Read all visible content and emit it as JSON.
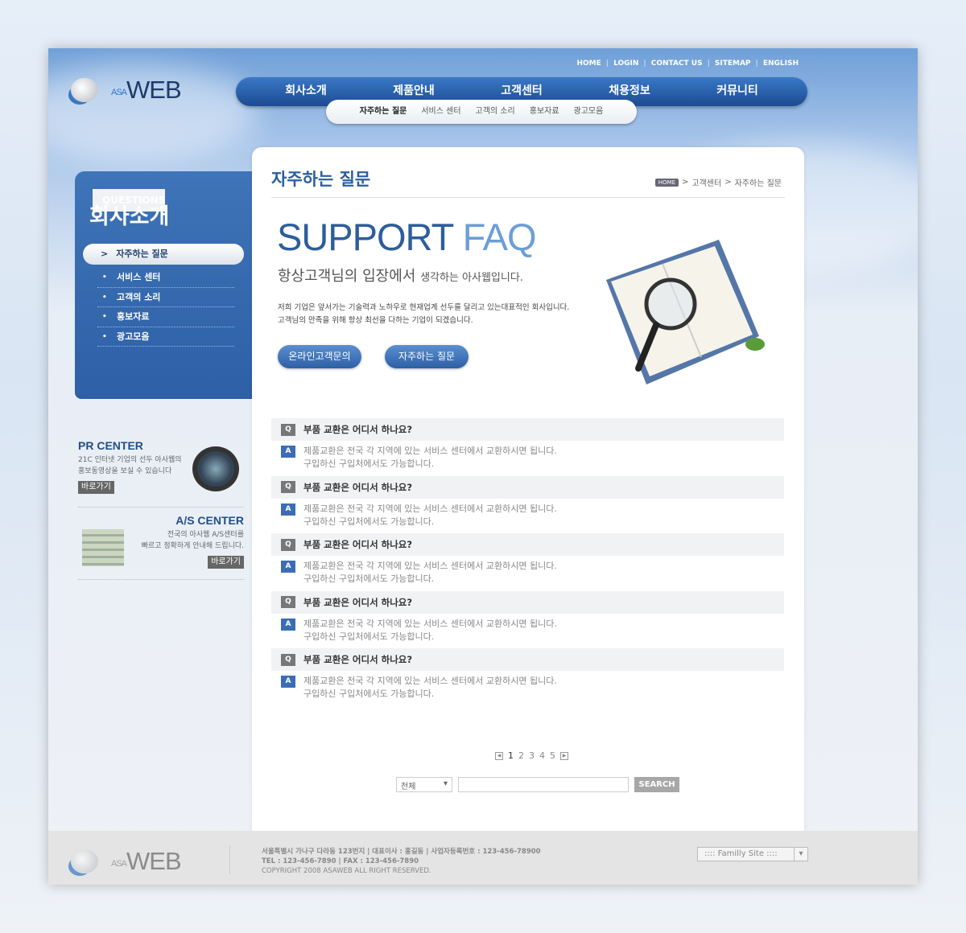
{
  "logo": {
    "a": "ASA",
    "b": "WEB"
  },
  "util_links": [
    "HOME",
    "LOGIN",
    "CONTACT US",
    "SITEMAP",
    "ENGLISH"
  ],
  "gnb": [
    "회사소개",
    "제품안내",
    "고객센터",
    "채용정보",
    "커뮤니티"
  ],
  "subnav": [
    "자주하는 질문",
    "서비스 센터",
    "고객의 소리",
    "홍보자료",
    "광고모음"
  ],
  "lnb": {
    "eyebrow": "QUESTIONS",
    "title": "회사소개",
    "active": "자주하는 질문",
    "items": [
      "서비스 센터",
      "고객의 소리",
      "홍보자료",
      "광고모음"
    ]
  },
  "pr": {
    "title": "PR CENTER",
    "line1": "21C 인터넷 기업의 선두 아사웹의",
    "line2": "홍보동영상을 보실 수 있습니다",
    "go": "바로가기"
  },
  "as": {
    "title": "A/S CENTER",
    "line1": "전국의 아사웹 A/S센터를",
    "line2": "빠르고 정확하게 안내해 드립니다.",
    "go": "바로가기"
  },
  "page": {
    "title": "자주하는 질문",
    "breadcrumb": [
      "HOME",
      "고객센터",
      "자주하는 질문"
    ],
    "hero_a": "SUPPORT",
    "hero_b": "FAQ",
    "lead": "항상고객님의 입장에서",
    "lead_small": "생각하는 아사웹입니다.",
    "desc1": "저희 기업은 앞서가는 기술력과 노하우로 현재업계 선두를 달리고 있는대표적인 회사입니다.",
    "desc2": "고객님의 만족을 위해 항상 최선을 다하는 기업이 되겠습니다.",
    "btn1": "온라인고객문의",
    "btn2": "자주하는 질문"
  },
  "faq": [
    {
      "q": "부품 교환은 어디서 하나요?",
      "a1": "제품교환은 전국 각 지역에 있는 서비스 센터에서 교환하시면 됩니다.",
      "a2": "구입하신 구입처에서도 가능합니다."
    },
    {
      "q": "부품 교환은 어디서 하나요?",
      "a1": "제품교환은 전국 각 지역에 있는 서비스 센터에서 교환하시면 됩니다.",
      "a2": "구입하신 구입처에서도 가능합니다."
    },
    {
      "q": "부품 교환은 어디서 하나요?",
      "a1": "제품교환은 전국 각 지역에 있는 서비스 센터에서 교환하시면 됩니다.",
      "a2": "구입하신 구입처에서도 가능합니다."
    },
    {
      "q": "부품 교환은 어디서 하나요?",
      "a1": "제품교환은 전국 각 지역에 있는 서비스 센터에서 교환하시면 됩니다.",
      "a2": "구입하신 구입처에서도 가능합니다."
    },
    {
      "q": "부품 교환은 어디서 하나요?",
      "a1": "제품교환은 전국 각 지역에 있는 서비스 센터에서 교환하시면 됩니다.",
      "a2": "구입하신 구입처에서도 가능합니다."
    }
  ],
  "tags": {
    "q": "Q",
    "a": "A"
  },
  "pager": {
    "prev": "◀",
    "next": "▶",
    "pages": [
      "1",
      "2",
      "3",
      "4",
      "5"
    ],
    "current": "1"
  },
  "search": {
    "select": "전체",
    "value": "",
    "button": "SEARCH"
  },
  "footer": {
    "line1": "서울특별시 가나구 다라동 123번지 | 대표이사 : 홍길동 | 사업자등록번호 : 123-456-78900",
    "line2": "TEL : 123-456-7890 | FAX : 123-456-7890",
    "copyright": "COPYRIGHT 2008 ASAWEB ALL RIGHT RESERVED.",
    "family": ":::: Familly Site ::::"
  }
}
